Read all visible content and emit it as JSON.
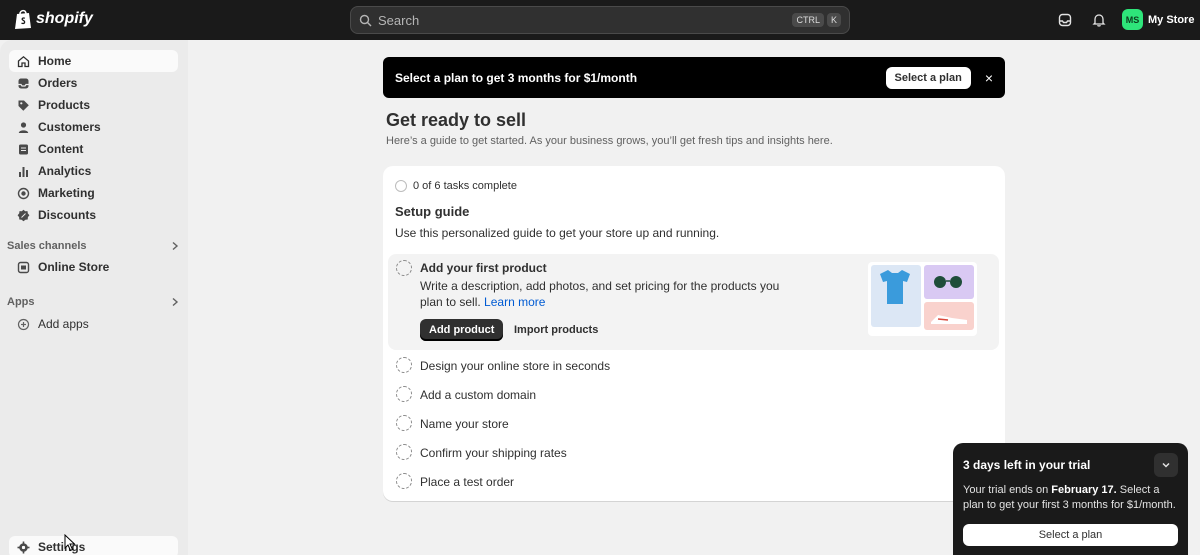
{
  "topbar": {
    "logo_text": "shopify",
    "search_placeholder": "Search",
    "shortcut_ctrl": "CTRL",
    "shortcut_key": "K",
    "store_initials": "MS",
    "store_name": "My Store"
  },
  "sidebar": {
    "items": [
      {
        "label": "Home",
        "icon": "home-icon"
      },
      {
        "label": "Orders",
        "icon": "inbox-icon"
      },
      {
        "label": "Products",
        "icon": "tag-icon"
      },
      {
        "label": "Customers",
        "icon": "person-icon"
      },
      {
        "label": "Content",
        "icon": "document-icon"
      },
      {
        "label": "Analytics",
        "icon": "bar-chart-icon"
      },
      {
        "label": "Marketing",
        "icon": "target-icon"
      },
      {
        "label": "Discounts",
        "icon": "discount-icon"
      }
    ],
    "sales_channels_label": "Sales channels",
    "online_store_label": "Online Store",
    "apps_label": "Apps",
    "add_apps_label": "Add apps",
    "settings_label": "Settings"
  },
  "banner": {
    "text": "Select a plan to get 3 months for $1/month",
    "button": "Select a plan",
    "close": "×"
  },
  "page": {
    "title": "Get ready to sell",
    "subtitle": "Here’s a guide to get started. As your business grows, you’ll get fresh tips and insights here."
  },
  "setup_guide": {
    "progress": "0 of 6 tasks complete",
    "title": "Setup guide",
    "description": "Use this personalized guide to get your store up and running.",
    "expanded_task": {
      "title": "Add your first product",
      "description": "Write a description, add photos, and set pricing for the products you plan to sell.",
      "link": "Learn more",
      "primary_button": "Add product",
      "secondary_button": "Import products"
    },
    "tasks": [
      "Design your online store in seconds",
      "Add a custom domain",
      "Name your store",
      "Confirm your shipping rates",
      "Place a test order"
    ]
  },
  "trial": {
    "title": "3 days left in your trial",
    "text_prefix": "Your trial ends on ",
    "date": "February 17.",
    "text_suffix": " Select a plan to get your first 3 months for $1/month.",
    "button": "Select a plan"
  }
}
